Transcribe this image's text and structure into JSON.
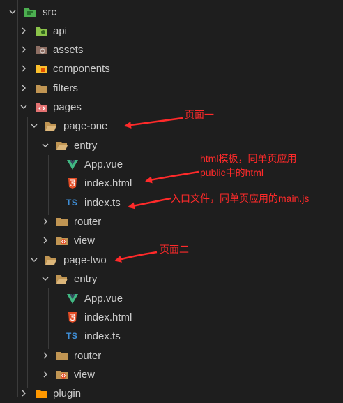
{
  "tree": {
    "root": {
      "label": "src",
      "icon": "src-folder-icon"
    },
    "items": [
      {
        "label": "api",
        "icon": "api-folder-icon"
      },
      {
        "label": "assets",
        "icon": "assets-folder-icon"
      },
      {
        "label": "components",
        "icon": "components-folder-icon"
      },
      {
        "label": "filters",
        "icon": "folder-icon"
      },
      {
        "label": "pages",
        "icon": "pages-folder-icon"
      },
      {
        "label": "page-one",
        "icon": "folder-open-icon"
      },
      {
        "label": "entry",
        "icon": "folder-open-icon"
      },
      {
        "label": "App.vue",
        "icon": "vue-icon"
      },
      {
        "label": "index.html",
        "icon": "html5-icon"
      },
      {
        "label": "index.ts",
        "icon": "typescript-icon",
        "badge": "TS"
      },
      {
        "label": "router",
        "icon": "folder-icon"
      },
      {
        "label": "view",
        "icon": "view-folder-icon"
      },
      {
        "label": "page-two",
        "icon": "folder-open-icon"
      },
      {
        "label": "entry",
        "icon": "folder-open-icon"
      },
      {
        "label": "App.vue",
        "icon": "vue-icon"
      },
      {
        "label": "index.html",
        "icon": "html5-icon"
      },
      {
        "label": "index.ts",
        "icon": "typescript-icon",
        "badge": "TS"
      },
      {
        "label": "router",
        "icon": "folder-icon"
      },
      {
        "label": "view",
        "icon": "view-folder-icon"
      },
      {
        "label": "plugin",
        "icon": "plugin-folder-icon"
      }
    ]
  },
  "annotations": {
    "page_one": "页面一",
    "html_template_line1": "html模板，同单页应用",
    "html_template_line2": "public中的html",
    "entry_file": "入口文件，同单页应用的main.js",
    "page_two": "页面二"
  },
  "colors": {
    "background": "#1e1e1e",
    "text": "#cccccc",
    "annotation": "#ff2a2a",
    "folder": "#c09553",
    "vue": "#41b883",
    "html": "#e44d26",
    "typescript": "#3f8fd8"
  }
}
